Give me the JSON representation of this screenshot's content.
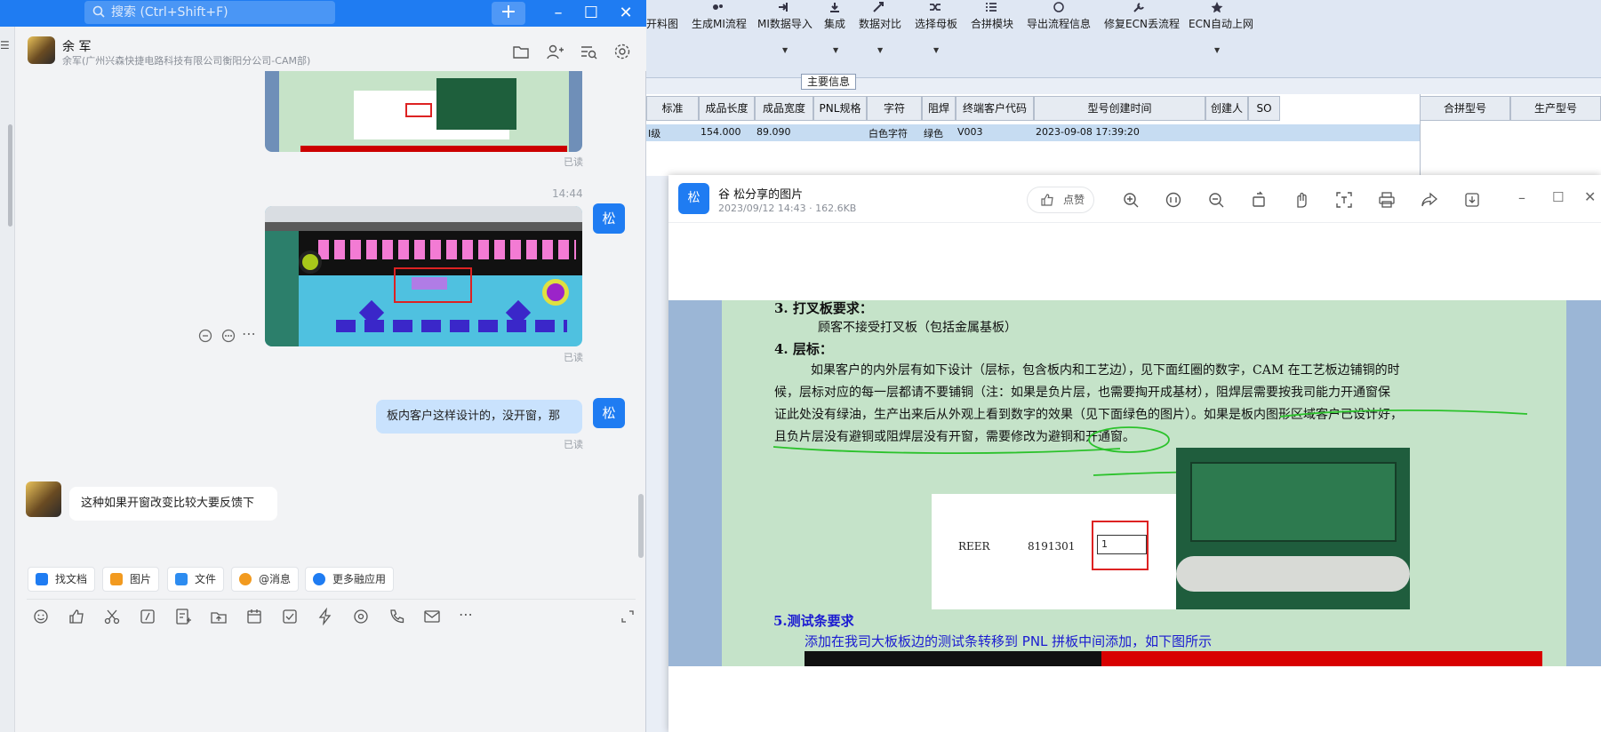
{
  "chat": {
    "search_placeholder": "搜索 (Ctrl+Shift+F)",
    "contact_name": "余 军",
    "contact_org": "余军(广州兴森快捷电路科技有限公司衡阳分公司-CAM部)",
    "timestamp": "14:44",
    "read_label": "已读",
    "my_avatar_label": "松",
    "outgoing_text": "板内客户这样设计的，没开窗，那",
    "incoming_text": "这种如果开窗改变比较大要反馈下",
    "quick_actions": [
      "找文档",
      "图片",
      "文件",
      "@消息",
      "更多融应用"
    ],
    "toolbar_icons": [
      "emoji-icon",
      "thumb-icon",
      "scissors-icon",
      "slash-icon",
      "note-icon",
      "upload-icon",
      "calendar-icon",
      "check-icon",
      "bolt-icon",
      "at-circle-icon",
      "phone-icon",
      "mail-icon",
      "more-icon"
    ]
  },
  "app": {
    "ribbon": [
      "开料图",
      "生成MI流程",
      "MI数据导入",
      "集成",
      "数据对比",
      "选择母板",
      "合拼模块",
      "导出流程信息",
      "修复ECN丢流程",
      "ECN自动上网"
    ],
    "group_label": "主要信息",
    "columns": [
      "标准",
      "成品长度",
      "成品宽度",
      "PNL规格",
      "字符",
      "阻焊",
      "终端客户代码",
      "型号创建时间",
      "创建人",
      "SO"
    ],
    "row": [
      "I级",
      "154.000",
      "89.090",
      "",
      "白色字符",
      "绿色",
      "V003",
      "2023-09-08 17:39:20",
      "",
      ""
    ],
    "right_columns": [
      "合拼型号",
      "生产型号"
    ]
  },
  "viewer": {
    "avatar": "松",
    "title": "谷  松分享的图片",
    "subtitle": "2023/09/12 14:43 · 162.6KB",
    "like_label": "点赞",
    "doc": {
      "s3_title": "3. 打叉板要求：",
      "s3_body": "顾客不接受打叉板（包括金属基板）",
      "s4_title": "4. 层标：",
      "s4_l1": "如果客户的内外层有如下设计（层标，包含板内和工艺边），见下面红圈的数字，CAM 在工艺板边铺铜的时",
      "s4_l2": "候，层标对应的每一层都请不要铺铜（注：如果是负片层，也需要掏开成基材），阻焊层需要按我司能力开通窗保",
      "s4_l3": "证此处没有绿油，生产出来后从外观上看到数字的效果（见下面绿色的图片）。如果是板内图形区域客户已设计好，",
      "s4_l4": "且负片层没有避铜或阻焊层没有开窗，需要修改为避铜和开通窗。",
      "fig_reer": "REER",
      "fig_num": "8191301",
      "fig_box": "1",
      "s5_title": "5.测试条要求",
      "s5_body": "添加在我司大板板边的测试条转移到 PNL 拼板中间添加，如下图所示"
    }
  }
}
